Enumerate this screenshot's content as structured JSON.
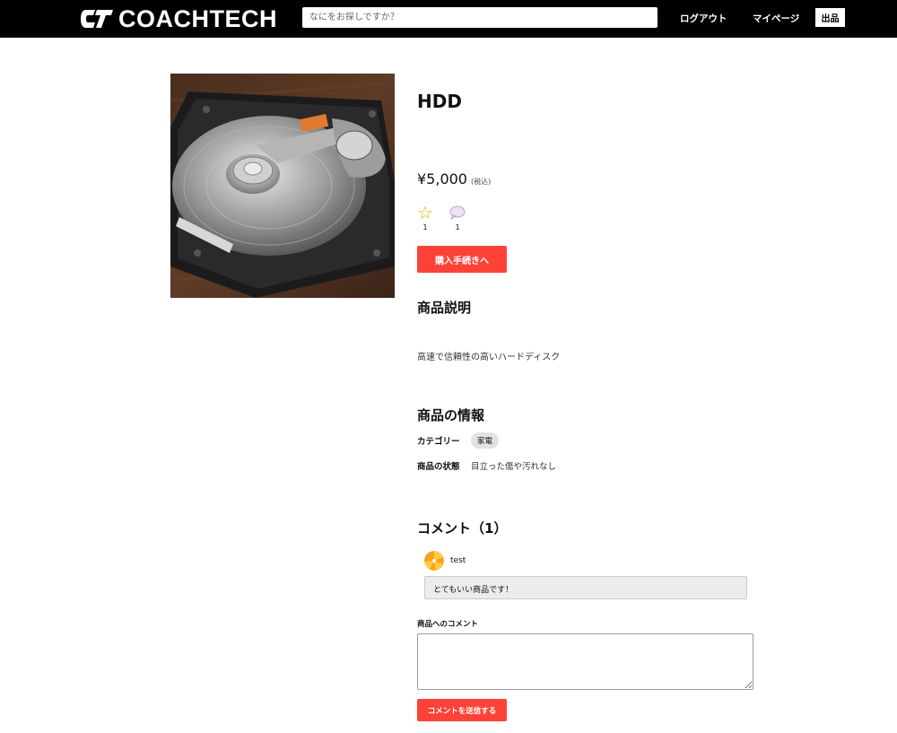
{
  "header": {
    "logo_text": "COACHTECH",
    "search_placeholder": "なにをお探しですか？",
    "logout_label": "ログアウト",
    "mypage_label": "マイページ",
    "sell_label": "出品"
  },
  "product": {
    "name": "HDD",
    "price": "¥5,000",
    "tax_note": "(税込)",
    "like_count": "1",
    "comment_count": "1",
    "buy_label": "購入手続きへ",
    "image_icon": "hard-drive-photo"
  },
  "description": {
    "title": "商品説明",
    "text": "高速で信頼性の高いハードディスク"
  },
  "info": {
    "title": "商品の情報",
    "category_label": "カテゴリー",
    "category_value": "家電",
    "condition_label": "商品の状態",
    "condition_value": "目立った傷や汚れなし"
  },
  "comments": {
    "title": "コメント（1）",
    "items": [
      {
        "user": "test",
        "text": "とてもいい商品です！"
      }
    ],
    "form_label": "商品へのコメント",
    "submit_label": "コメントを送信する"
  },
  "colors": {
    "header_bg": "#000000",
    "accent_red": "#ff4238",
    "star": "#e6b800"
  }
}
